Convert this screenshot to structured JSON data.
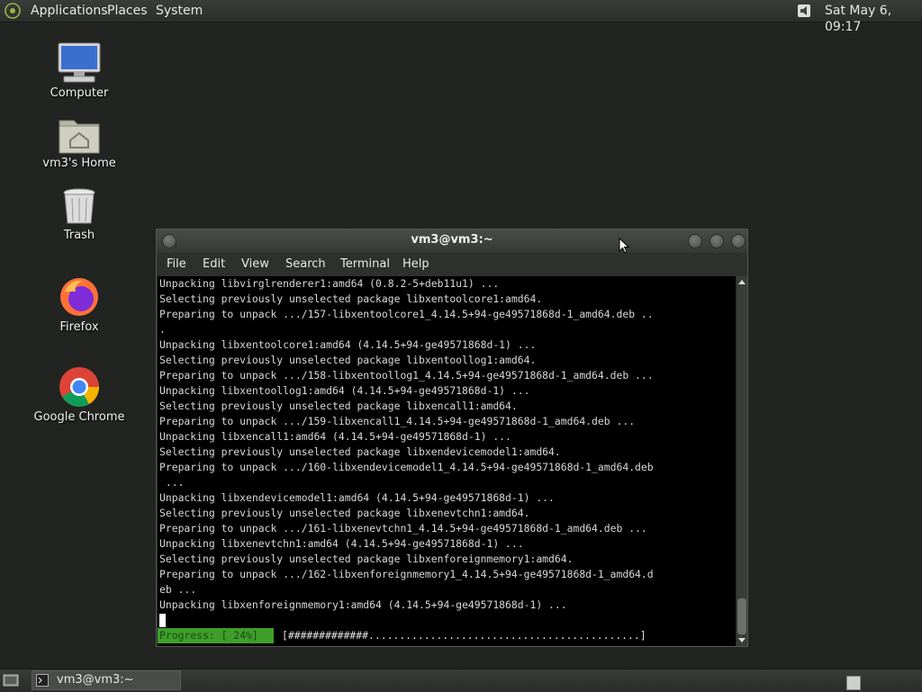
{
  "top_panel": {
    "menus": [
      "Applications",
      "Places",
      "System"
    ],
    "clock": "Sat May  6, 09:17",
    "volume_icon": "speaker-icon"
  },
  "desktop": {
    "icons": [
      {
        "label": "Computer",
        "icon": "computer-icon"
      },
      {
        "label": "vm3's Home",
        "icon": "home-folder-icon"
      },
      {
        "label": "Trash",
        "icon": "trash-icon"
      },
      {
        "label": "Firefox",
        "icon": "firefox-icon"
      },
      {
        "label": "Google Chrome",
        "icon": "chrome-icon"
      }
    ]
  },
  "terminal": {
    "title": "vm3@vm3:~",
    "menu": [
      "File",
      "Edit",
      "View",
      "Search",
      "Terminal",
      "Help"
    ],
    "lines": [
      "Unpacking libvirglrenderer1:amd64 (0.8.2-5+deb11u1) ...",
      "Selecting previously unselected package libxentoolcore1:amd64.",
      "Preparing to unpack .../157-libxentoolcore1_4.14.5+94-ge49571868d-1_amd64.deb ..",
      ".",
      "Unpacking libxentoolcore1:amd64 (4.14.5+94-ge49571868d-1) ...",
      "Selecting previously unselected package libxentoollog1:amd64.",
      "Preparing to unpack .../158-libxentoollog1_4.14.5+94-ge49571868d-1_amd64.deb ...",
      "Unpacking libxentoollog1:amd64 (4.14.5+94-ge49571868d-1) ...",
      "Selecting previously unselected package libxencall1:amd64.",
      "Preparing to unpack .../159-libxencall1_4.14.5+94-ge49571868d-1_amd64.deb ...",
      "Unpacking libxencall1:amd64 (4.14.5+94-ge49571868d-1) ...",
      "Selecting previously unselected package libxendevicemodel1:amd64.",
      "Preparing to unpack .../160-libxendevicemodel1_4.14.5+94-ge49571868d-1_amd64.deb",
      " ...",
      "Unpacking libxendevicemodel1:amd64 (4.14.5+94-ge49571868d-1) ...",
      "Selecting previously unselected package libxenevtchn1:amd64.",
      "Preparing to unpack .../161-libxenevtchn1_4.14.5+94-ge49571868d-1_amd64.deb ...",
      "Unpacking libxenevtchn1:amd64 (4.14.5+94-ge49571868d-1) ...",
      "Selecting previously unselected package libxenforeignmemory1:amd64.",
      "Preparing to unpack .../162-libxenforeignmemory1_4.14.5+94-ge49571868d-1_amd64.d",
      "eb ...",
      "Unpacking libxenforeignmemory1:amd64 (4.14.5+94-ge49571868d-1) ..."
    ],
    "progress_label": "Progress: [ 24%]",
    "progress_bar": "[#############............................................]"
  },
  "taskbar": {
    "task_label": "vm3@vm3:~"
  },
  "colors": {
    "desktop_bg": "#222421",
    "progress_green": "#3e9e2a",
    "terminal_bg": "#000000"
  }
}
